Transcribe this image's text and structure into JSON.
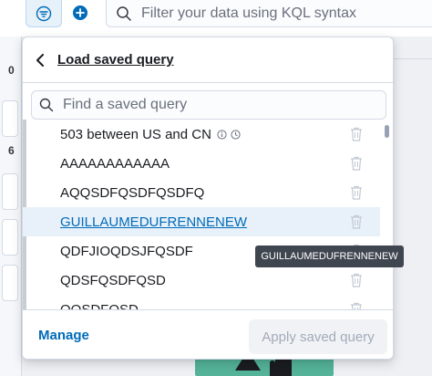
{
  "top": {
    "kql_placeholder": "Filter your data using KQL syntax",
    "left_numbers": [
      "0",
      "6"
    ]
  },
  "popover": {
    "title": "Load saved query",
    "search_placeholder": "Find a saved query",
    "items": [
      {
        "label": "503 between US and CN",
        "has_info": true,
        "highlighted": false
      },
      {
        "label": "AAAAAAAAAAAA",
        "has_info": false,
        "highlighted": false
      },
      {
        "label": "AQQSDFQSDFQSDFQ",
        "has_info": false,
        "highlighted": false
      },
      {
        "label": "GUILLAUMEDUFRENNENEW",
        "has_info": false,
        "highlighted": true
      },
      {
        "label": "QDFJIOQDSJFQSDF",
        "has_info": false,
        "highlighted": false
      },
      {
        "label": "QDSFQSDFQSD",
        "has_info": false,
        "highlighted": false
      },
      {
        "label": "QQSDFQSD",
        "has_info": false,
        "highlighted": false
      }
    ],
    "manage_label": "Manage",
    "apply_label": "Apply saved query"
  },
  "tooltip": {
    "text": "GUILLAUMEDUFRENNENEW"
  },
  "colors": {
    "accent": "#006bb8",
    "highlight_bg": "#e8f1fa",
    "tooltip_bg": "#404650"
  },
  "icons": [
    "filter-icon",
    "plus-circle-icon",
    "search-icon",
    "back-arrow-icon",
    "info-icon",
    "clock-icon",
    "trash-icon"
  ]
}
